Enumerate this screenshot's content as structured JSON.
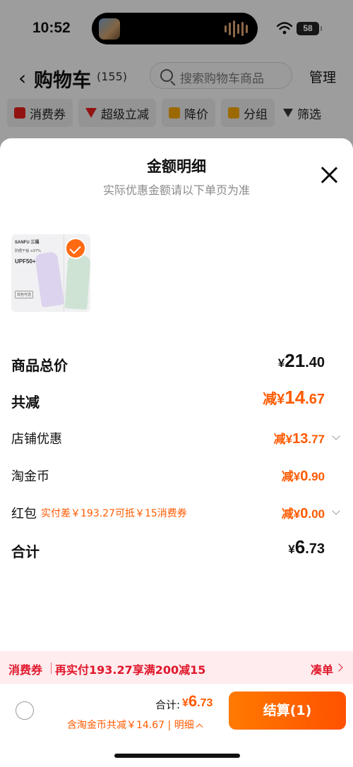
{
  "status_bar": {
    "time": "10:52",
    "battery": "58"
  },
  "nav": {
    "title": "购物车",
    "count": "(155)",
    "search_placeholder": "搜索购物车商品",
    "manage": "管理"
  },
  "filters": [
    "消费券",
    "超级立减",
    "降价",
    "分组",
    "筛选"
  ],
  "sheet": {
    "title": "金额明细",
    "subtitle": "实际优惠金额请以下单页为准",
    "product_thumb": {
      "brand": "SANFU 三福",
      "line1": "防晒干袖 ≥97%",
      "line2": "UPF50+",
      "tag": "双色可选"
    },
    "rows": {
      "total_price": {
        "label": "商品总价",
        "currency": "¥",
        "int": "21",
        "dec": ".40"
      },
      "total_discount": {
        "label": "共减",
        "prefix": "减¥",
        "int": "14",
        "dec": ".67"
      },
      "store_discount": {
        "label": "店铺优惠",
        "prefix": "减¥",
        "int": "13",
        "dec": ".77"
      },
      "coins": {
        "label": "淘金币",
        "prefix": "减¥",
        "int": "0",
        "dec": ".90"
      },
      "red_packet": {
        "label": "红包",
        "note": "实付差￥193.27可抵￥15消费券",
        "prefix": "减¥",
        "int": "0",
        "dec": ".00"
      },
      "sum": {
        "label": "合计",
        "currency": "¥",
        "int": "6",
        "dec": ".73"
      }
    }
  },
  "coupon_bar": {
    "tag": "消费券",
    "text": "再实付193.27享满200减15",
    "link": "凑单"
  },
  "footer": {
    "total_label": "合计:",
    "total_currency": "¥",
    "total_int": "6",
    "total_dec": ".73",
    "discount_text": "含淘金币共减￥14.67 | 明细",
    "checkout": "结算(1)"
  },
  "colors": {
    "accent": "#ff5a00",
    "coupon_red": "#e0172c",
    "checkout_gradient_start": "#ff7a00"
  }
}
